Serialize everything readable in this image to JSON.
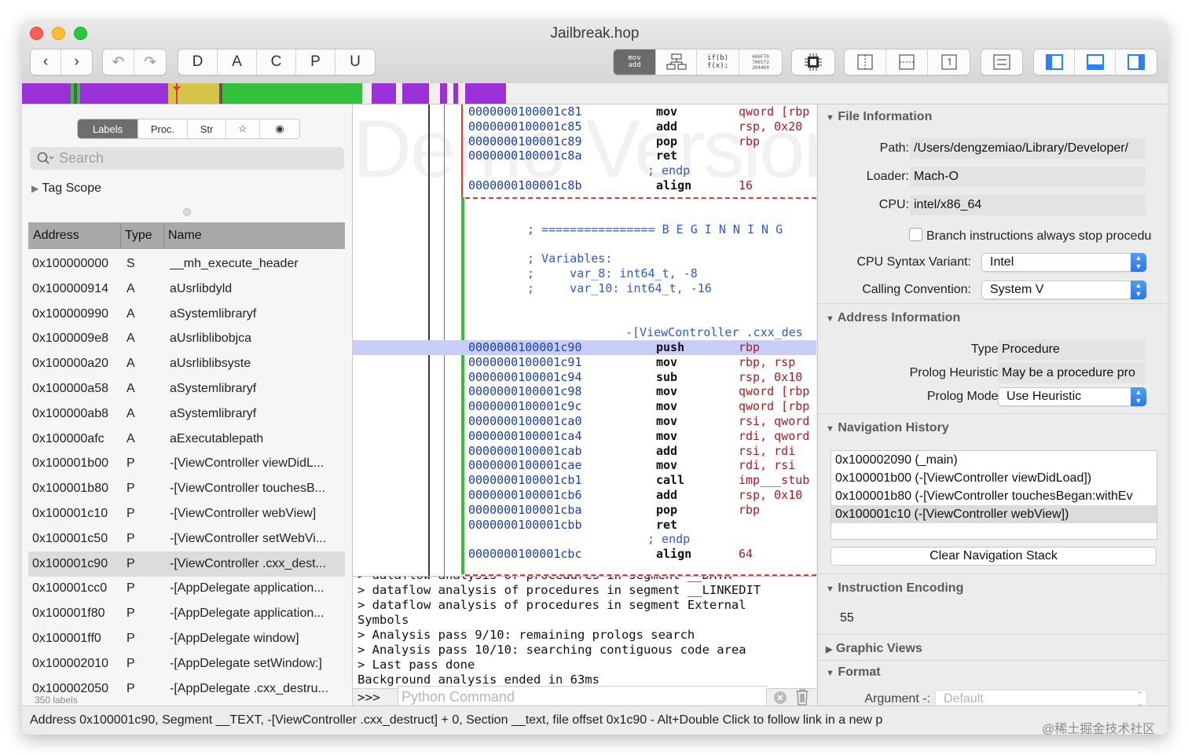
{
  "window": {
    "title": "Jailbreak.hop"
  },
  "toolbar": {
    "mode_buttons": [
      "D",
      "A",
      "C",
      "P",
      "U"
    ],
    "asm_button": {
      "line1": "mov",
      "line2": "add"
    },
    "pseudo_button": {
      "line1": "if(b)",
      "line2": "f(x);"
    },
    "hex_button": {
      "line1": "486F70",
      "line2": "706572",
      "line3": "204469"
    }
  },
  "colors": {
    "procedure": "#9b30d9",
    "code": "#33c13c",
    "data": "#d4c44a",
    "cursor": "#e33b2d",
    "accent": "#2f7ff0"
  },
  "left_panel": {
    "tabs": [
      "Labels",
      "Proc.",
      "Str",
      "☆",
      "◉"
    ],
    "search_placeholder": "Search",
    "tag_scope": "Tag Scope",
    "columns": [
      "Address",
      "Type",
      "Name"
    ],
    "rows": [
      {
        "address": "0x100000000",
        "type": "S",
        "name": "__mh_execute_header"
      },
      {
        "address": "0x100000914",
        "type": "A",
        "name": "aUsrlibdyld"
      },
      {
        "address": "0x100000990",
        "type": "A",
        "name": "aSystemlibraryf"
      },
      {
        "address": "0x1000009e8",
        "type": "A",
        "name": "aUsrliblibobjca"
      },
      {
        "address": "0x100000a20",
        "type": "A",
        "name": "aUsrliblibsyste"
      },
      {
        "address": "0x100000a58",
        "type": "A",
        "name": "aSystemlibraryf"
      },
      {
        "address": "0x100000ab8",
        "type": "A",
        "name": "aSystemlibraryf"
      },
      {
        "address": "0x100000afc",
        "type": "A",
        "name": "aExecutablepath"
      },
      {
        "address": "0x100001b00",
        "type": "P",
        "name": "-[ViewController viewDidL..."
      },
      {
        "address": "0x100001b80",
        "type": "P",
        "name": "-[ViewController touchesB..."
      },
      {
        "address": "0x100001c10",
        "type": "P",
        "name": "-[ViewController webView]"
      },
      {
        "address": "0x100001c50",
        "type": "P",
        "name": "-[ViewController setWebVi..."
      },
      {
        "address": "0x100001c90",
        "type": "P",
        "name": "-[ViewController .cxx_dest..."
      },
      {
        "address": "0x100001cc0",
        "type": "P",
        "name": "-[AppDelegate application..."
      },
      {
        "address": "0x100001f80",
        "type": "P",
        "name": "-[AppDelegate application..."
      },
      {
        "address": "0x100001ff0",
        "type": "P",
        "name": "-[AppDelegate window]"
      },
      {
        "address": "0x100002010",
        "type": "P",
        "name": "-[AppDelegate setWindow:]"
      },
      {
        "address": "0x100002050",
        "type": "P",
        "name": "-[AppDelegate .cxx_destru..."
      }
    ],
    "selected_index": 12,
    "count": "350 labels"
  },
  "code": {
    "watermark": "Demo Version",
    "block1": [
      {
        "addr": "0000000100001c81",
        "mn": "mov",
        "op": "qword [rbp"
      },
      {
        "addr": "0000000100001c85",
        "mn": "add",
        "op": "rsp, 0x20"
      },
      {
        "addr": "0000000100001c89",
        "mn": "pop",
        "op": "rbp"
      },
      {
        "addr": "0000000100001c8a",
        "mn": "ret",
        "op": ""
      }
    ],
    "endp1": "; endp",
    "align1": {
      "addr": "0000000100001c8b",
      "mn": "align",
      "op": "16"
    },
    "beginning": "; ================ B E G I N N I N G",
    "variables": "; Variables:",
    "var1": ";     var_8: int64_t, -8",
    "var2": ";     var_10: int64_t, -16",
    "proc_label": "-[ViewController .cxx_des",
    "block2": [
      {
        "addr": "0000000100001c90",
        "mn": "push",
        "op": "rbp"
      },
      {
        "addr": "0000000100001c91",
        "mn": "mov",
        "op": "rbp, rsp"
      },
      {
        "addr": "0000000100001c94",
        "mn": "sub",
        "op": "rsp, 0x10"
      },
      {
        "addr": "0000000100001c98",
        "mn": "mov",
        "op": "qword [rbp"
      },
      {
        "addr": "0000000100001c9c",
        "mn": "mov",
        "op": "qword [rbp"
      },
      {
        "addr": "0000000100001ca0",
        "mn": "mov",
        "op": "rsi, qword"
      },
      {
        "addr": "0000000100001ca4",
        "mn": "mov",
        "op": "rdi, qword"
      },
      {
        "addr": "0000000100001cab",
        "mn": "add",
        "op": "rsi, rdi"
      },
      {
        "addr": "0000000100001cae",
        "mn": "mov",
        "op": "rdi, rsi"
      },
      {
        "addr": "0000000100001cb1",
        "mn": "call",
        "op": "imp___stub"
      },
      {
        "addr": "0000000100001cb6",
        "mn": "add",
        "op": "rsp, 0x10"
      },
      {
        "addr": "0000000100001cba",
        "mn": "pop",
        "op": "rbp"
      },
      {
        "addr": "0000000100001cbb",
        "mn": "ret",
        "op": ""
      }
    ],
    "endp2": "; endp",
    "align2": {
      "addr": "0000000100001cbc",
      "mn": "align",
      "op": "64"
    }
  },
  "console": {
    "lines": [
      "> dataflow analysis of procedures in segment __DATA",
      "> dataflow analysis of procedures in segment __LINKEDIT",
      "> dataflow analysis of procedures in segment External",
      "Symbols",
      "> Analysis pass 9/10: remaining prologs search",
      "> Analysis pass 10/10: searching contiguous code area",
      "> Last pass done",
      "Background analysis ended in 63ms"
    ],
    "prompt": ">>>",
    "input_placeholder": "Python Command"
  },
  "inspector": {
    "file_info": {
      "title": "File Information",
      "path_label": "Path:",
      "path": "/Users/dengzemiao/Library/Developer/",
      "loader_label": "Loader:",
      "loader": "Mach-O",
      "cpu_label": "CPU:",
      "cpu": "intel/x86_64",
      "branch_checkbox": "Branch instructions always stop procedu",
      "syntax_label": "CPU Syntax Variant:",
      "syntax": "Intel",
      "convention_label": "Calling Convention:",
      "convention": "System V"
    },
    "address_info": {
      "title": "Address Information",
      "type_label": "Type:",
      "type": "Procedure",
      "heuristic_label": "Prolog Heuristic:",
      "heuristic": "May be a procedure pro",
      "mode_label": "Prolog Mode:",
      "mode": "Use Heuristic"
    },
    "nav_history": {
      "title": "Navigation History",
      "items": [
        "0x100002090 (_main)",
        "0x100001b00 (-[ViewController viewDidLoad])",
        "0x100001b80 (-[ViewController touchesBegan:withEv",
        "0x100001c10 (-[ViewController webView])"
      ],
      "selected_index": 3,
      "clear_button": "Clear Navigation Stack"
    },
    "encoding": {
      "title": "Instruction Encoding",
      "value": "55"
    },
    "graphic_views": {
      "title": "Graphic Views"
    },
    "format": {
      "title": "Format",
      "argument_label": "Argument -:",
      "argument": "Default"
    }
  },
  "status": "Address 0x100001c90, Segment __TEXT, -[ViewController .cxx_destruct] + 0, Section __text, file offset 0x1c90 - Alt+Double Click to follow link in a new p",
  "watermark": "@稀土掘金技术社区"
}
